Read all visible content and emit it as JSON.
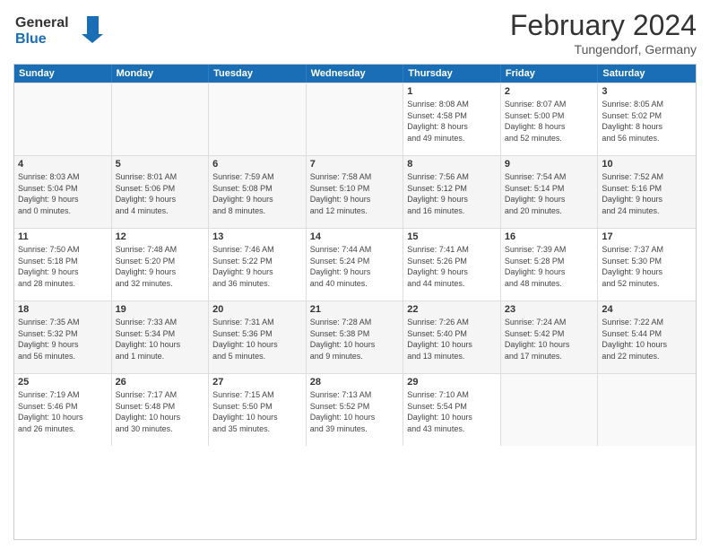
{
  "header": {
    "logo_line1": "General",
    "logo_line2": "Blue",
    "main_title": "February 2024",
    "subtitle": "Tungendorf, Germany"
  },
  "days_of_week": [
    "Sunday",
    "Monday",
    "Tuesday",
    "Wednesday",
    "Thursday",
    "Friday",
    "Saturday"
  ],
  "weeks": [
    {
      "bg": "white",
      "cells": [
        {
          "day": "",
          "info": ""
        },
        {
          "day": "",
          "info": ""
        },
        {
          "day": "",
          "info": ""
        },
        {
          "day": "",
          "info": ""
        },
        {
          "day": "1",
          "info": "Sunrise: 8:08 AM\nSunset: 4:58 PM\nDaylight: 8 hours\nand 49 minutes."
        },
        {
          "day": "2",
          "info": "Sunrise: 8:07 AM\nSunset: 5:00 PM\nDaylight: 8 hours\nand 52 minutes."
        },
        {
          "day": "3",
          "info": "Sunrise: 8:05 AM\nSunset: 5:02 PM\nDaylight: 8 hours\nand 56 minutes."
        }
      ]
    },
    {
      "bg": "gray",
      "cells": [
        {
          "day": "4",
          "info": "Sunrise: 8:03 AM\nSunset: 5:04 PM\nDaylight: 9 hours\nand 0 minutes."
        },
        {
          "day": "5",
          "info": "Sunrise: 8:01 AM\nSunset: 5:06 PM\nDaylight: 9 hours\nand 4 minutes."
        },
        {
          "day": "6",
          "info": "Sunrise: 7:59 AM\nSunset: 5:08 PM\nDaylight: 9 hours\nand 8 minutes."
        },
        {
          "day": "7",
          "info": "Sunrise: 7:58 AM\nSunset: 5:10 PM\nDaylight: 9 hours\nand 12 minutes."
        },
        {
          "day": "8",
          "info": "Sunrise: 7:56 AM\nSunset: 5:12 PM\nDaylight: 9 hours\nand 16 minutes."
        },
        {
          "day": "9",
          "info": "Sunrise: 7:54 AM\nSunset: 5:14 PM\nDaylight: 9 hours\nand 20 minutes."
        },
        {
          "day": "10",
          "info": "Sunrise: 7:52 AM\nSunset: 5:16 PM\nDaylight: 9 hours\nand 24 minutes."
        }
      ]
    },
    {
      "bg": "white",
      "cells": [
        {
          "day": "11",
          "info": "Sunrise: 7:50 AM\nSunset: 5:18 PM\nDaylight: 9 hours\nand 28 minutes."
        },
        {
          "day": "12",
          "info": "Sunrise: 7:48 AM\nSunset: 5:20 PM\nDaylight: 9 hours\nand 32 minutes."
        },
        {
          "day": "13",
          "info": "Sunrise: 7:46 AM\nSunset: 5:22 PM\nDaylight: 9 hours\nand 36 minutes."
        },
        {
          "day": "14",
          "info": "Sunrise: 7:44 AM\nSunset: 5:24 PM\nDaylight: 9 hours\nand 40 minutes."
        },
        {
          "day": "15",
          "info": "Sunrise: 7:41 AM\nSunset: 5:26 PM\nDaylight: 9 hours\nand 44 minutes."
        },
        {
          "day": "16",
          "info": "Sunrise: 7:39 AM\nSunset: 5:28 PM\nDaylight: 9 hours\nand 48 minutes."
        },
        {
          "day": "17",
          "info": "Sunrise: 7:37 AM\nSunset: 5:30 PM\nDaylight: 9 hours\nand 52 minutes."
        }
      ]
    },
    {
      "bg": "gray",
      "cells": [
        {
          "day": "18",
          "info": "Sunrise: 7:35 AM\nSunset: 5:32 PM\nDaylight: 9 hours\nand 56 minutes."
        },
        {
          "day": "19",
          "info": "Sunrise: 7:33 AM\nSunset: 5:34 PM\nDaylight: 10 hours\nand 1 minute."
        },
        {
          "day": "20",
          "info": "Sunrise: 7:31 AM\nSunset: 5:36 PM\nDaylight: 10 hours\nand 5 minutes."
        },
        {
          "day": "21",
          "info": "Sunrise: 7:28 AM\nSunset: 5:38 PM\nDaylight: 10 hours\nand 9 minutes."
        },
        {
          "day": "22",
          "info": "Sunrise: 7:26 AM\nSunset: 5:40 PM\nDaylight: 10 hours\nand 13 minutes."
        },
        {
          "day": "23",
          "info": "Sunrise: 7:24 AM\nSunset: 5:42 PM\nDaylight: 10 hours\nand 17 minutes."
        },
        {
          "day": "24",
          "info": "Sunrise: 7:22 AM\nSunset: 5:44 PM\nDaylight: 10 hours\nand 22 minutes."
        }
      ]
    },
    {
      "bg": "white",
      "cells": [
        {
          "day": "25",
          "info": "Sunrise: 7:19 AM\nSunset: 5:46 PM\nDaylight: 10 hours\nand 26 minutes."
        },
        {
          "day": "26",
          "info": "Sunrise: 7:17 AM\nSunset: 5:48 PM\nDaylight: 10 hours\nand 30 minutes."
        },
        {
          "day": "27",
          "info": "Sunrise: 7:15 AM\nSunset: 5:50 PM\nDaylight: 10 hours\nand 35 minutes."
        },
        {
          "day": "28",
          "info": "Sunrise: 7:13 AM\nSunset: 5:52 PM\nDaylight: 10 hours\nand 39 minutes."
        },
        {
          "day": "29",
          "info": "Sunrise: 7:10 AM\nSunset: 5:54 PM\nDaylight: 10 hours\nand 43 minutes."
        },
        {
          "day": "",
          "info": ""
        },
        {
          "day": "",
          "info": ""
        }
      ]
    }
  ]
}
